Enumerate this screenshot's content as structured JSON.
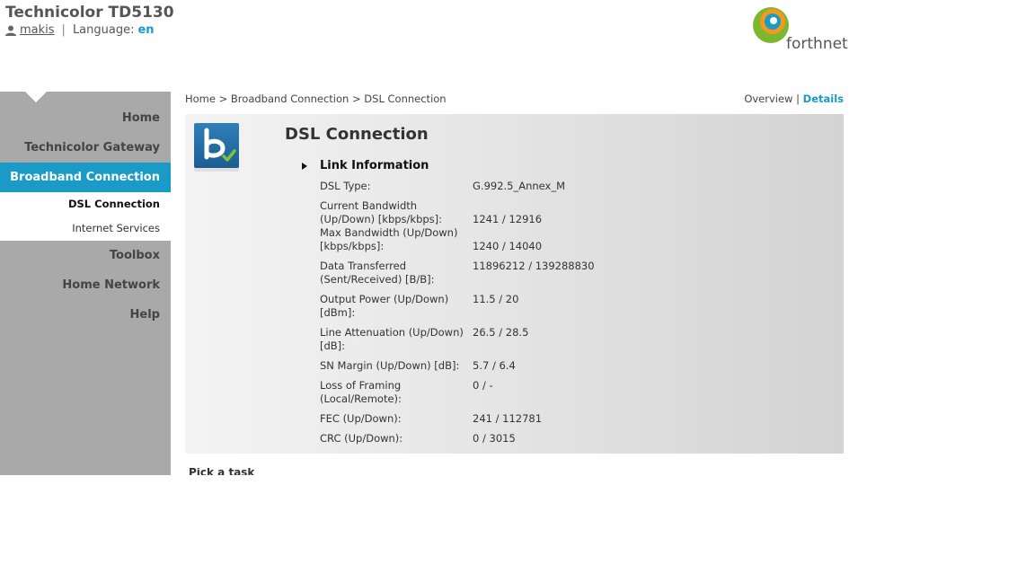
{
  "header": {
    "title": "Technicolor TD5130",
    "user": "makis",
    "language_label": "Language:",
    "language_value": "en"
  },
  "brand": {
    "logo_text": "forthnet"
  },
  "sidebar": {
    "items": [
      {
        "label": "Home"
      },
      {
        "label": "Technicolor Gateway"
      },
      {
        "label": "Broadband Connection"
      },
      {
        "label": "Toolbox"
      },
      {
        "label": "Home Network"
      },
      {
        "label": "Help"
      }
    ],
    "subitems": [
      {
        "label": "DSL Connection"
      },
      {
        "label": "Internet Services"
      }
    ]
  },
  "breadcrumb": {
    "home": "Home",
    "section": "Broadband Connection",
    "page": "DSL Connection",
    "separator": ">"
  },
  "view": {
    "overview": "Overview",
    "separator": "|",
    "details": "Details"
  },
  "panel": {
    "title": "DSL Connection",
    "section": "Link Information",
    "rows": [
      {
        "label": "DSL Type:",
        "value": "G.992.5_Annex_M"
      },
      {
        "label": "Current Bandwidth (Up/Down) [kbps/kbps]:",
        "value": "1241 / 12916"
      },
      {
        "label": "Max Bandwidth (Up/Down) [kbps/kbps]:",
        "value": "1240 / 14040"
      },
      {
        "label": "Data Transferred (Sent/Received) [B/B]:",
        "value": "11896212 / 139288830"
      },
      {
        "label": "Output Power (Up/Down) [dBm]:",
        "value": "11.5 / 20"
      },
      {
        "label": "Line Attenuation (Up/Down) [dB]:",
        "value": "26.5 / 28.5"
      },
      {
        "label": "SN Margin (Up/Down) [dB]:",
        "value": "5.7 / 6.4"
      },
      {
        "label": "Loss of Framing (Local/Remote):",
        "value": "0 / -"
      },
      {
        "label": "FEC (Up/Down):",
        "value": "241 / 112781"
      },
      {
        "label": "CRC (Up/Down):",
        "value": "0 / 3015"
      }
    ]
  },
  "footer": {
    "pick_task": "Pick a task"
  },
  "colors": {
    "accent": "#1a9bc7",
    "sidebar": "#a9a9a9"
  }
}
